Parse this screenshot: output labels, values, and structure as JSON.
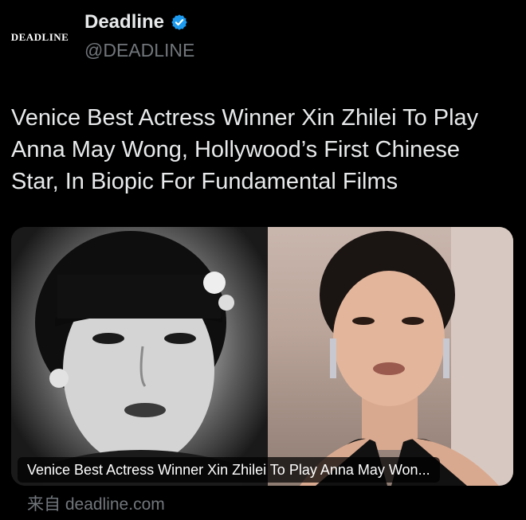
{
  "account": {
    "logo_text": "DEADLINE",
    "display_name": "Deadline",
    "handle": "@DEADLINE",
    "verified_color": "#1d9bf0"
  },
  "post": {
    "headline": "Venice Best Actress Winner Xin Zhilei To Play Anna May Wong, Hollywood’s First Chinese Star, In Biopic For Fundamental Films"
  },
  "link_card": {
    "caption": "Venice Best Actress Winner Xin Zhilei To Play Anna May Won...",
    "source": "来自 deadline.com",
    "images": [
      "vintage black-and-white portrait",
      "color red-carpet portrait"
    ]
  }
}
